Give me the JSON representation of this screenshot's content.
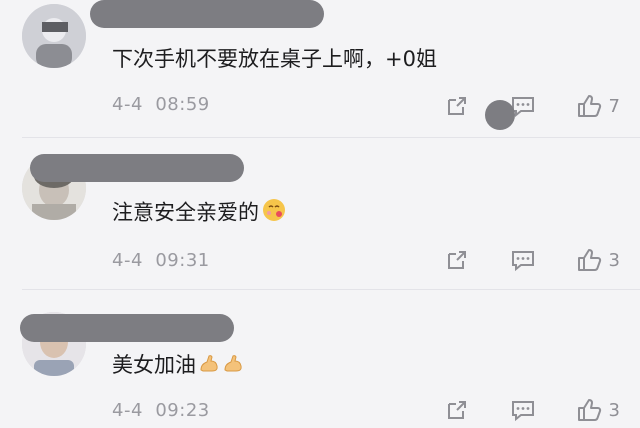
{
  "comments": [
    {
      "text": "下次手机不要放在桌子上啊，+0姐",
      "date": "4-4",
      "time": "08:59",
      "likes": "7",
      "emoji": []
    },
    {
      "text": "注意安全亲爱的",
      "date": "4-4",
      "time": "09:31",
      "likes": "3",
      "emoji": [
        "face-kiss-emoji"
      ]
    },
    {
      "text": "美女加油",
      "date": "4-4",
      "time": "09:23",
      "likes": "3",
      "emoji": [
        "flexed-biceps-emoji",
        "flexed-biceps-emoji"
      ]
    }
  ],
  "colors": {
    "background": "#f4f4f6",
    "meta_text": "#9a9aa0",
    "redaction": "#7d7d82"
  }
}
